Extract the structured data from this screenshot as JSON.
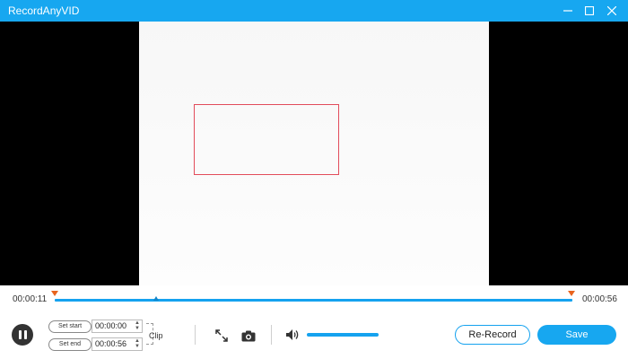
{
  "app": {
    "title": "RecordAnyVID",
    "window_controls": [
      "minimize-icon",
      "maximize-icon",
      "close-icon"
    ]
  },
  "timeline": {
    "current_time": "00:00:11",
    "end_time": "00:00:56"
  },
  "controls": {
    "play_state_icon": "pause-icon",
    "set_start_label": "Set start",
    "set_end_label": "Set end",
    "start_value": "00:00:00",
    "end_value": "00:00:56",
    "clip_label": "Clip",
    "fullscreen_icon": "expand-icon",
    "snapshot_icon": "camera-icon",
    "volume_icon": "speaker-icon",
    "rerecord_label": "Re-Record",
    "save_label": "Save"
  },
  "colors": {
    "accent": "#17a7f0",
    "selection": "#e24c5b",
    "marker": "#e8641e"
  }
}
